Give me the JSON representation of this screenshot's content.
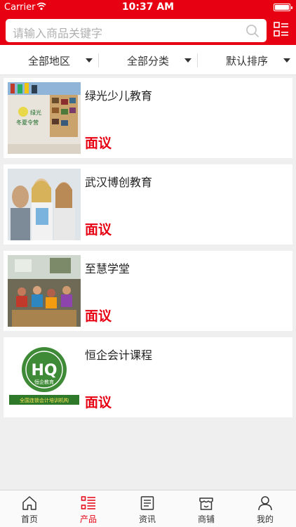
{
  "status_bar": {
    "carrier": "Carrier",
    "time": "10:37 AM"
  },
  "search": {
    "placeholder": "请输入商品关键字"
  },
  "filters": [
    "全部地区",
    "全部分类",
    "默认排序"
  ],
  "items": [
    {
      "title": "绿光少儿教育",
      "price": "面议"
    },
    {
      "title": "武汉博创教育",
      "price": "面议"
    },
    {
      "title": "至慧学堂",
      "price": "面议"
    },
    {
      "title": "恒企会计课程",
      "price": "面议"
    }
  ],
  "thumb_texts": {
    "item1": [
      "绿光",
      "冬夏令营"
    ],
    "item4": [
      "恒企教育",
      "全国连锁会计培训机构"
    ]
  },
  "tabs": [
    {
      "label": "首页",
      "icon": "home-icon"
    },
    {
      "label": "产品",
      "icon": "list-icon",
      "active": true
    },
    {
      "label": "资讯",
      "icon": "news-icon"
    },
    {
      "label": "商铺",
      "icon": "shop-icon"
    },
    {
      "label": "我的",
      "icon": "user-icon"
    }
  ],
  "colors": {
    "accent": "#e60012",
    "background": "#efefef",
    "tab_inactive": "#333333"
  }
}
